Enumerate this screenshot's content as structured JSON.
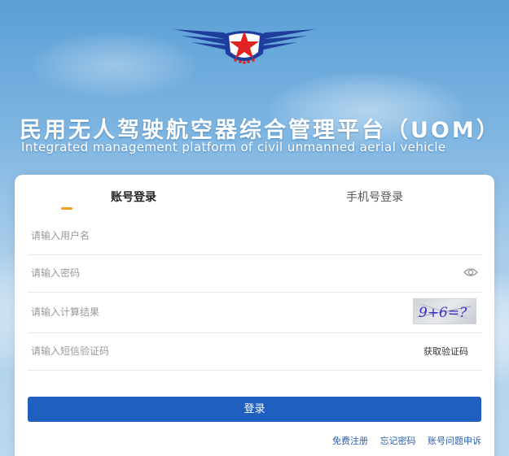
{
  "header": {
    "title": "民用无人驾驶航空器综合管理平台（UOM）",
    "subtitle": "Integrated management platform of civil unmanned aerial vehicle",
    "logo_icon": "winged-star-emblem-icon"
  },
  "tabs": {
    "account_label": "账号登录",
    "phone_label": "手机号登录",
    "active": "account"
  },
  "form": {
    "username_placeholder": "请输入用户名",
    "password_placeholder": "请输入密码",
    "password_toggle_icon": "eye-icon",
    "captcha_placeholder": "请输入计算结果",
    "captcha_text": "9+6=?",
    "sms_placeholder": "请输入短信验证码",
    "sms_button_label": "获取验证码",
    "login_button_label": "登录"
  },
  "footer_links": {
    "register": "免费注册",
    "forgot_password": "忘记密码",
    "account_appeal": "账号问题申诉"
  },
  "colors": {
    "primary_button": "#1f5fbf",
    "tab_indicator": "#f0a020",
    "emblem_blue": "#1f3d9c",
    "emblem_red": "#e02424",
    "link_text": "#2a5fad"
  }
}
